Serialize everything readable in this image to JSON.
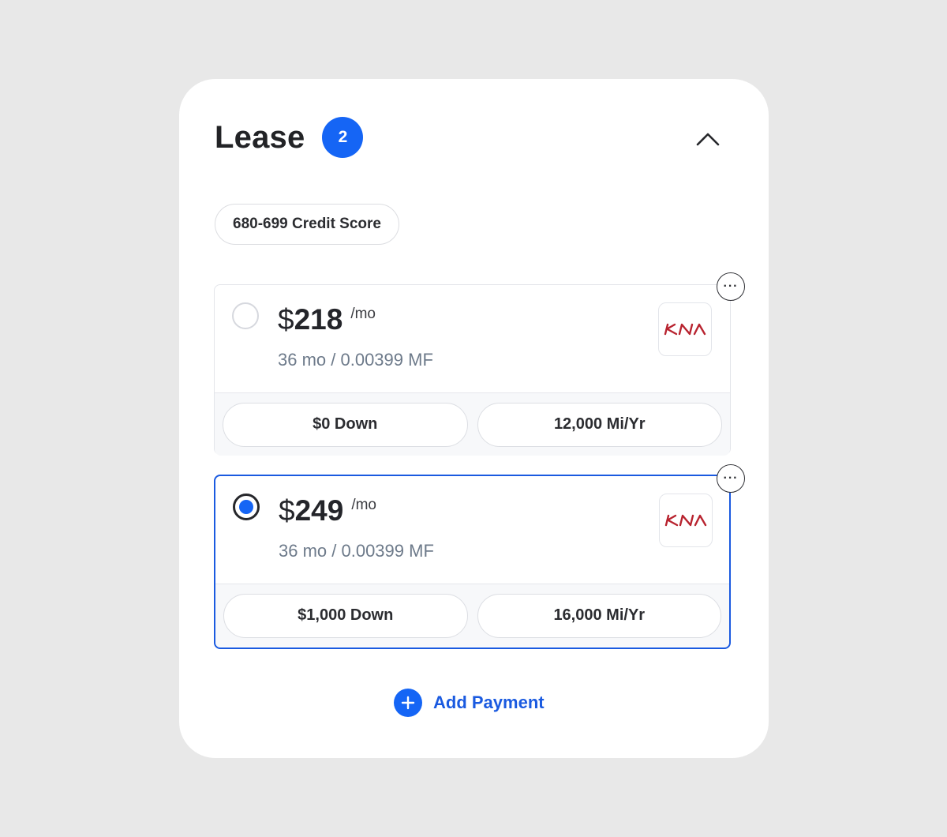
{
  "section": {
    "title": "Lease",
    "count": "2"
  },
  "filter_chip": {
    "label": "680-699 Credit Score"
  },
  "options": [
    {
      "currency": "$",
      "amount": "218",
      "per": "/mo",
      "terms": "36 mo / 0.00399 MF",
      "down": "$0 Down",
      "mileage": "12,000 Mi/Yr",
      "selected": false,
      "logo": "kia-logo"
    },
    {
      "currency": "$",
      "amount": "249",
      "per": "/mo",
      "terms": "36 mo / 0.00399 MF",
      "down": "$1,000 Down",
      "mileage": "16,000 Mi/Yr",
      "selected": true,
      "logo": "kia-logo"
    }
  ],
  "more_label": "···",
  "add_payment": {
    "label": "Add Payment"
  },
  "colors": {
    "accent": "#1565f5",
    "selected_border": "#1a5ae0",
    "kia_red": "#b8232f",
    "muted_text": "#6d7a8a"
  },
  "icons": {
    "collapse": "chevron-up-icon",
    "more": "more-horizontal-icon",
    "add": "plus-icon"
  }
}
